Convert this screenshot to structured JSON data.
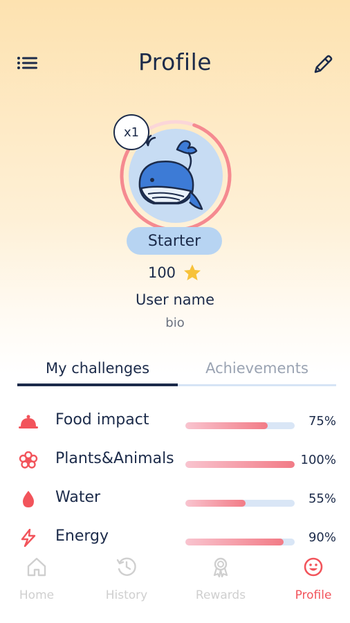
{
  "header": {
    "title": "Profile"
  },
  "profile": {
    "multiplier": "x1",
    "level": "Starter",
    "points": "100",
    "username": "User name",
    "bio": "bio",
    "level_progress": 0.85
  },
  "tabs": [
    {
      "label": "My challenges",
      "active": true
    },
    {
      "label": "Achievements",
      "active": false
    }
  ],
  "challenges": [
    {
      "label": "Food impact",
      "percent_text": "75%",
      "progress": 0.75,
      "icon": "food-cloche-icon"
    },
    {
      "label": "Plants&Animals",
      "percent_text": "100%",
      "progress": 1.0,
      "icon": "flower-icon"
    },
    {
      "label": "Water",
      "percent_text": "55%",
      "progress": 0.55,
      "icon": "water-drop-icon"
    },
    {
      "label": "Energy",
      "percent_text": "90%",
      "progress": 0.9,
      "icon": "lightning-icon"
    }
  ],
  "bottom_nav": [
    {
      "label": "Home",
      "icon": "home-icon",
      "active": false
    },
    {
      "label": "History",
      "icon": "history-icon",
      "active": false
    },
    {
      "label": "Rewards",
      "icon": "rewards-icon",
      "active": false
    },
    {
      "label": "Profile",
      "icon": "profile-smile-icon",
      "active": true
    }
  ],
  "colors": {
    "navy": "#1c2b4a",
    "accent": "#f2545b",
    "badge": "#b7d4f2",
    "inactive": "#cfcfcf"
  }
}
